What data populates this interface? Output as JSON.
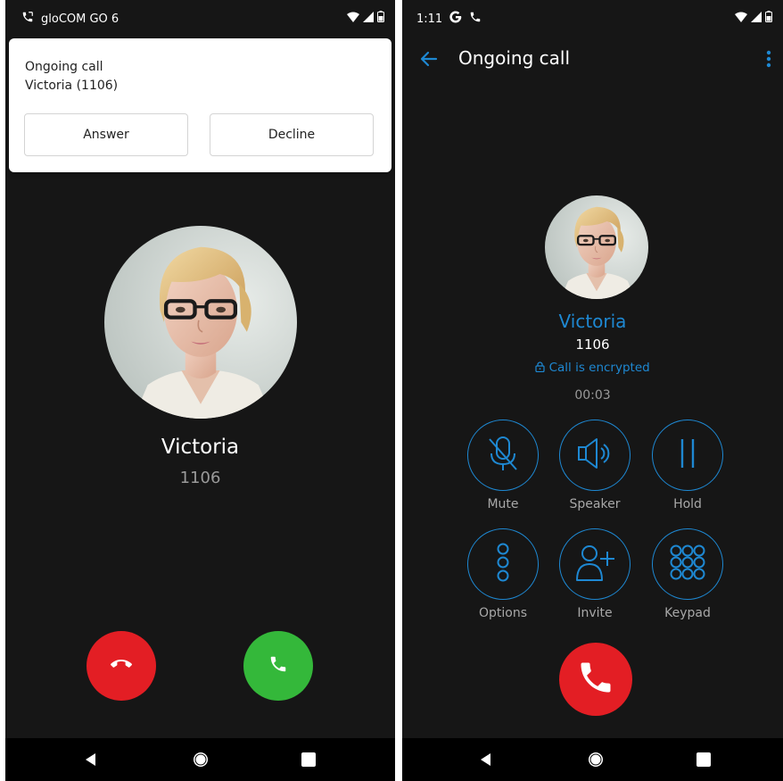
{
  "left_screen": {
    "status_bar": {
      "app_label": "gloCOM GO 6"
    },
    "notification": {
      "title": "Ongoing call",
      "subtitle": "Victoria (1106)",
      "answer_label": "Answer",
      "decline_label": "Decline"
    },
    "caller": {
      "name": "Victoria",
      "extension": "1106"
    },
    "colors": {
      "decline": "#e31e24",
      "answer": "#34b83a"
    }
  },
  "right_screen": {
    "status_bar": {
      "time": "1:11"
    },
    "app_bar": {
      "title": "Ongoing call"
    },
    "caller": {
      "name": "Victoria",
      "extension": "1106",
      "encryption_status": "Call is encrypted",
      "duration": "00:03"
    },
    "controls": [
      {
        "label": "Mute",
        "icon": "microphone-off-icon"
      },
      {
        "label": "Speaker",
        "icon": "speaker-icon"
      },
      {
        "label": "Hold",
        "icon": "pause-icon"
      },
      {
        "label": "Options",
        "icon": "options-dots-icon"
      },
      {
        "label": "Invite",
        "icon": "add-person-icon"
      },
      {
        "label": "Keypad",
        "icon": "dialpad-icon"
      }
    ],
    "colors": {
      "accent": "#1e88d2",
      "hangup": "#e31e24"
    }
  },
  "navigation": {
    "buttons": [
      "back",
      "home",
      "recents"
    ]
  }
}
